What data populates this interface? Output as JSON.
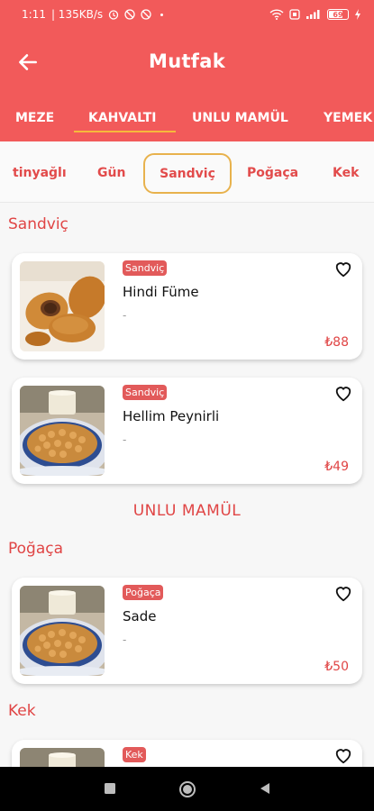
{
  "status_bar": {
    "time": "1:11",
    "speed": "| 135KB/s",
    "battery": "69"
  },
  "app_bar": {
    "title": "Mutfak"
  },
  "category_tabs": [
    {
      "label": "MEZE"
    },
    {
      "label": "KAHVALTI"
    },
    {
      "label": "UNLU MAMÜL"
    },
    {
      "label": "YEMEK"
    }
  ],
  "sub_tabs": [
    {
      "label": "tinyağlı"
    },
    {
      "label": "Gün"
    },
    {
      "label": "Sandviç"
    },
    {
      "label": "Poğaça"
    },
    {
      "label": "Kek"
    }
  ],
  "sections": {
    "sandvic": "Sandviç",
    "unlu_mamul": "UNLU MAMÜL",
    "pogaca": "Poğaça",
    "kek": "Kek"
  },
  "cards": [
    {
      "badge": "Sandviç",
      "name": "Hindi Füme",
      "desc": "-",
      "price": "₺88"
    },
    {
      "badge": "Sandviç",
      "name": "Hellim Peynirli",
      "desc": "-",
      "price": "₺49"
    },
    {
      "badge": "Poğaça",
      "name": "Sade",
      "desc": "-",
      "price": "₺50"
    },
    {
      "badge": "Kek",
      "name": "",
      "desc": "",
      "price": ""
    }
  ],
  "colors": {
    "primary": "#f25a5a",
    "accent": "#e04545",
    "highlight": "#e8b24d"
  }
}
